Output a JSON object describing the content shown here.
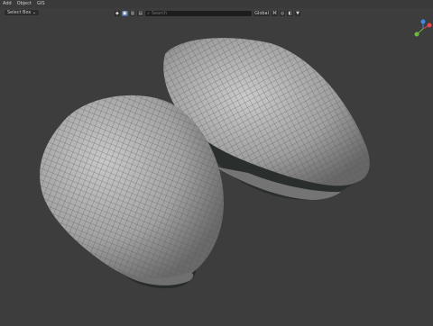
{
  "menu": {
    "items": [
      "Add",
      "Object",
      "GIS"
    ]
  },
  "select_box": {
    "label": "Select Box ⌄"
  },
  "toolbar": {
    "global_label": "Global",
    "search_placeholder": "Search"
  },
  "colors": {
    "viewport_bg": "#3d3d3d",
    "mesh_surface": "#a6a6a6",
    "wire": "#4a4a4a",
    "gizmo_x": "#e8454c",
    "gizmo_y": "#70b73f",
    "gizmo_z": "#3f8be8"
  },
  "icons": {
    "search": "search-icon",
    "filter": "filter-icon",
    "overlays": "overlays-icon",
    "snap": "snap-icon"
  }
}
